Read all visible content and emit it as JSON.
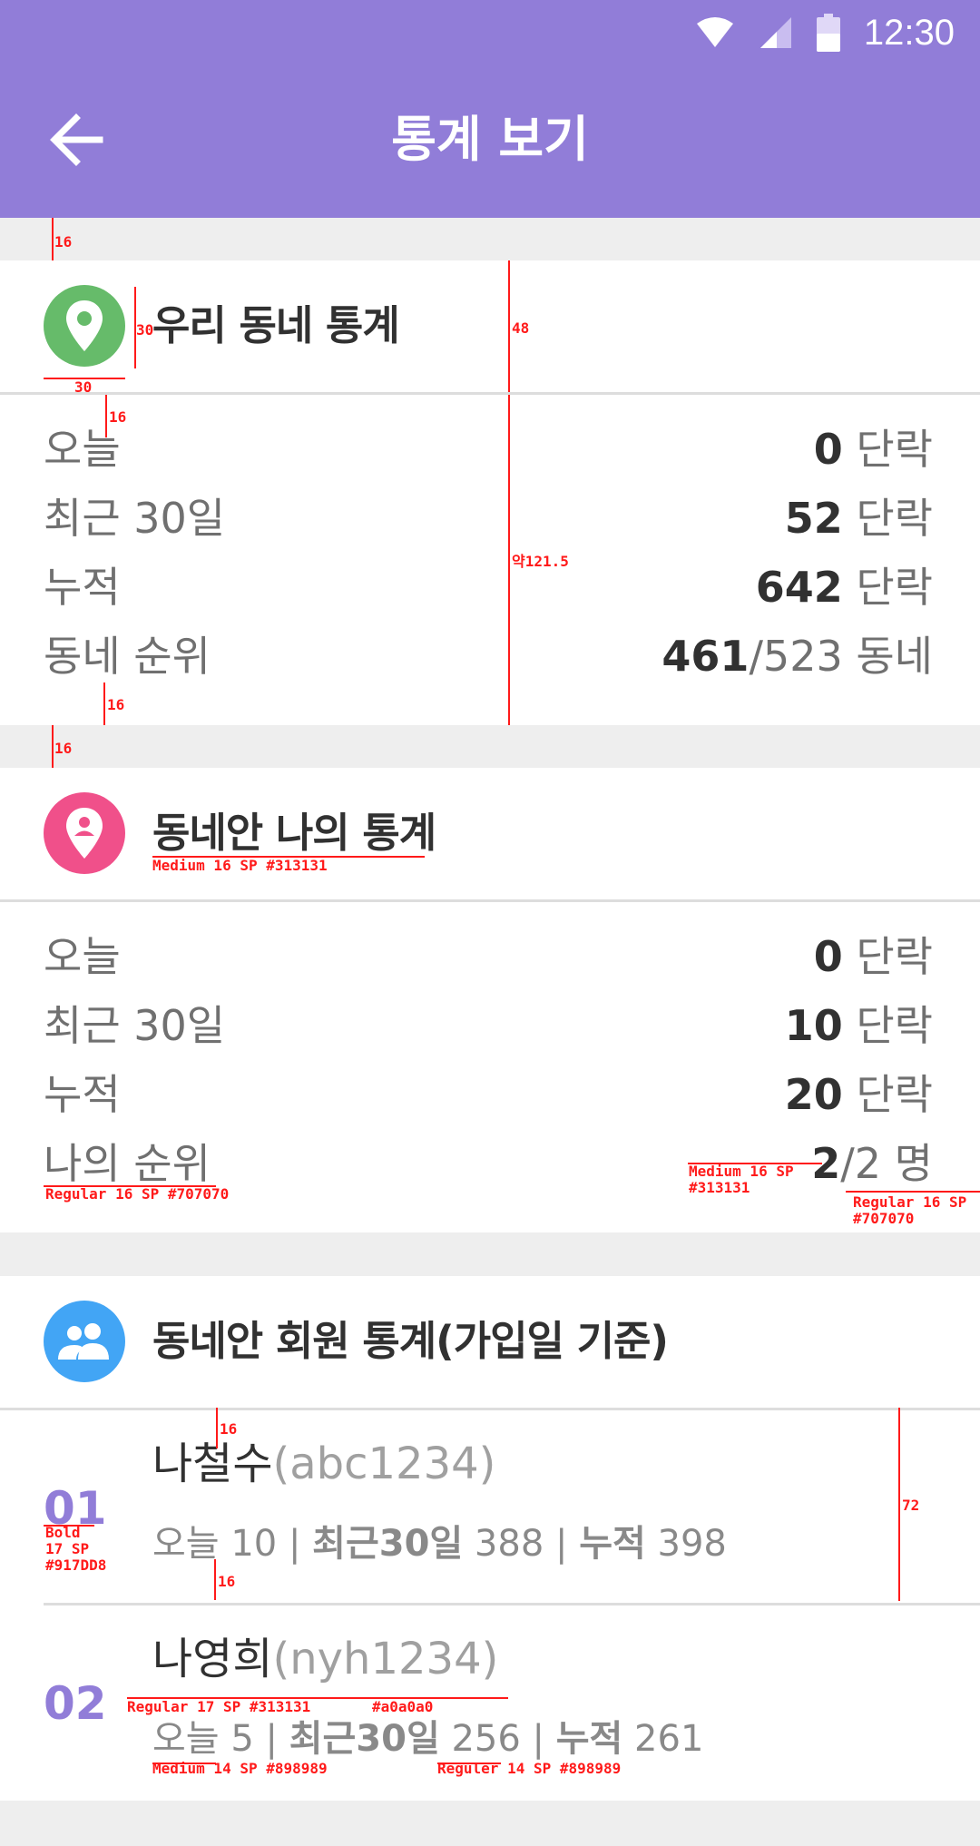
{
  "status_bar": {
    "time": "12:30",
    "icons": [
      "wifi-icon",
      "signal-icon",
      "battery-icon"
    ]
  },
  "app_bar": {
    "title": "통계 보기",
    "back_icon": "arrow-left-icon",
    "color": "#917DD8"
  },
  "neighborhood_stats": {
    "title": "우리 동네 통계",
    "icon": "location-pin-icon",
    "icon_color": "#66BB6A",
    "rows": [
      {
        "label": "오늘",
        "value": "0",
        "unit": " 단락"
      },
      {
        "label": "최근 30일",
        "value": "52",
        "unit": " 단락"
      },
      {
        "label": "누적",
        "value": "642",
        "unit": " 단락"
      },
      {
        "label": "동네 순위",
        "value": "461",
        "unit": "/523 동네"
      }
    ]
  },
  "my_stats": {
    "title": "동네안 나의 통계",
    "icon": "location-person-icon",
    "icon_color": "#F0508A",
    "rows": [
      {
        "label": "오늘",
        "value": "0",
        "unit": " 단락"
      },
      {
        "label": "최근 30일",
        "value": "10",
        "unit": " 단락"
      },
      {
        "label": "누적",
        "value": "20",
        "unit": " 단락"
      },
      {
        "label": "나의 순위",
        "value": "2",
        "unit": "/2 명"
      }
    ]
  },
  "member_stats": {
    "title": "동네안 회원 통계(가입일 기준)",
    "icon": "people-icon",
    "icon_color": "#42A5F5",
    "members": [
      {
        "rank": "01",
        "name": "나철수",
        "id": "(abc1234)",
        "today_label": "오늘 ",
        "today": "10",
        "recent_label": "최근30일",
        "recent": " 388",
        "total_label": "누적",
        "total": " 398"
      },
      {
        "rank": "02",
        "name": "나영희",
        "id": "(nyh1234)",
        "today_label": "오늘 ",
        "today": "5",
        "recent_label": "최근30일",
        "recent": " 256",
        "total_label": "누적",
        "total": " 261"
      }
    ]
  },
  "annotations": {
    "a16": "16",
    "a30": "30",
    "a48": "48",
    "a121": "약121.5",
    "a72": "72",
    "head_spec": "Medium 16 SP  #313131",
    "label_spec": "Regular 16 SP  #707070",
    "val_spec_1": "Medium 16 SP",
    "val_spec_2": "#313131",
    "unit_spec_1": "Regular 16 SP",
    "unit_spec_2": "#707070",
    "rank_spec_1": "Bold",
    "rank_spec_2": "17 SP",
    "rank_spec_3": "#917DD8",
    "name_spec": "Regular 17 SP #313131",
    "id_spec": "#a0a0a0",
    "stat_label_spec": "Medium 14 SP #898989",
    "stat_value_spec": "Reguler 14 SP #898989"
  }
}
